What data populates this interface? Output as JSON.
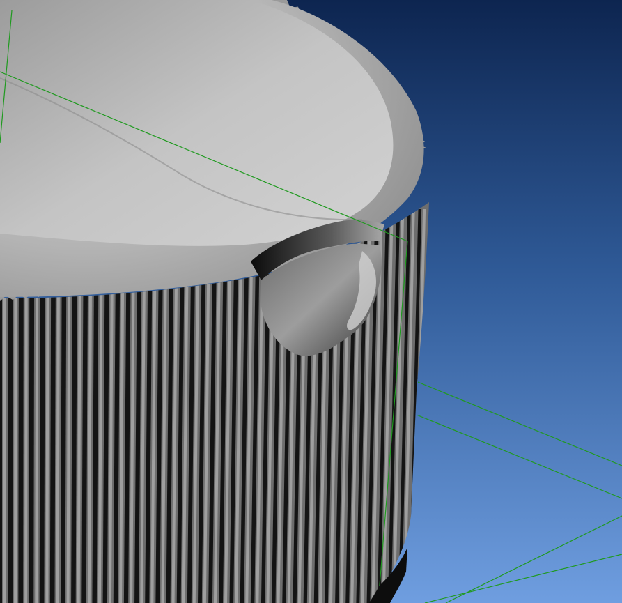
{
  "viewport": {
    "background_top": "#0d2550",
    "background_bottom": "#6f9ee0",
    "grid_color": "#1f9a1f",
    "model_light": "#c8c8c8",
    "model_mid": "#8a8a8a",
    "model_dark": "#141414",
    "model_icon": "knurled-cylinder-cap-icon"
  }
}
